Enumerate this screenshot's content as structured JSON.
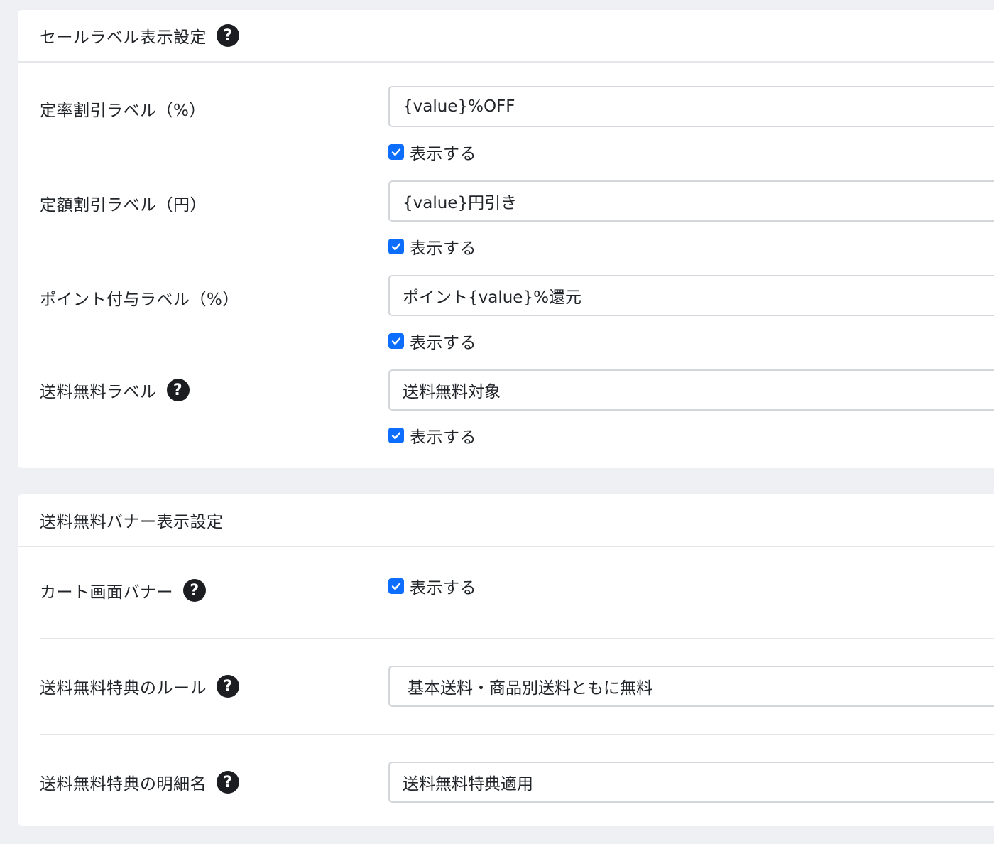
{
  "sale_label_settings": {
    "title": "セールラベル表示設定",
    "rows": [
      {
        "label": "定率割引ラベル（%）",
        "value": "{value}%OFF",
        "checkbox_label": "表示する",
        "checked": true
      },
      {
        "label": "定額割引ラベル（円）",
        "value": "{value}円引き",
        "checkbox_label": "表示する",
        "checked": true
      },
      {
        "label": "ポイント付与ラベル（%）",
        "value": "ポイント{value}%還元",
        "checkbox_label": "表示する",
        "checked": true
      },
      {
        "label": "送料無料ラベル",
        "value": "送料無料対象",
        "checkbox_label": "表示する",
        "checked": true
      }
    ]
  },
  "free_shipping_banner_settings": {
    "title": "送料無料バナー表示設定",
    "cart_banner": {
      "label": "カート画面バナー",
      "checkbox_label": "表示する",
      "checked": true
    },
    "rule": {
      "label": "送料無料特典のルール",
      "selected": "基本送料・商品別送料ともに無料"
    },
    "detail_name": {
      "label": "送料無料特典の明細名",
      "value": "送料無料特典適用"
    }
  },
  "icons": {
    "help": "question-circle-icon",
    "check": "checkmark-icon"
  },
  "colors": {
    "background": "#eff0f4",
    "card": "#ffffff",
    "checkbox": "#0d6efd",
    "help_icon": "#1c1d21",
    "border": "#d3d7dc"
  }
}
